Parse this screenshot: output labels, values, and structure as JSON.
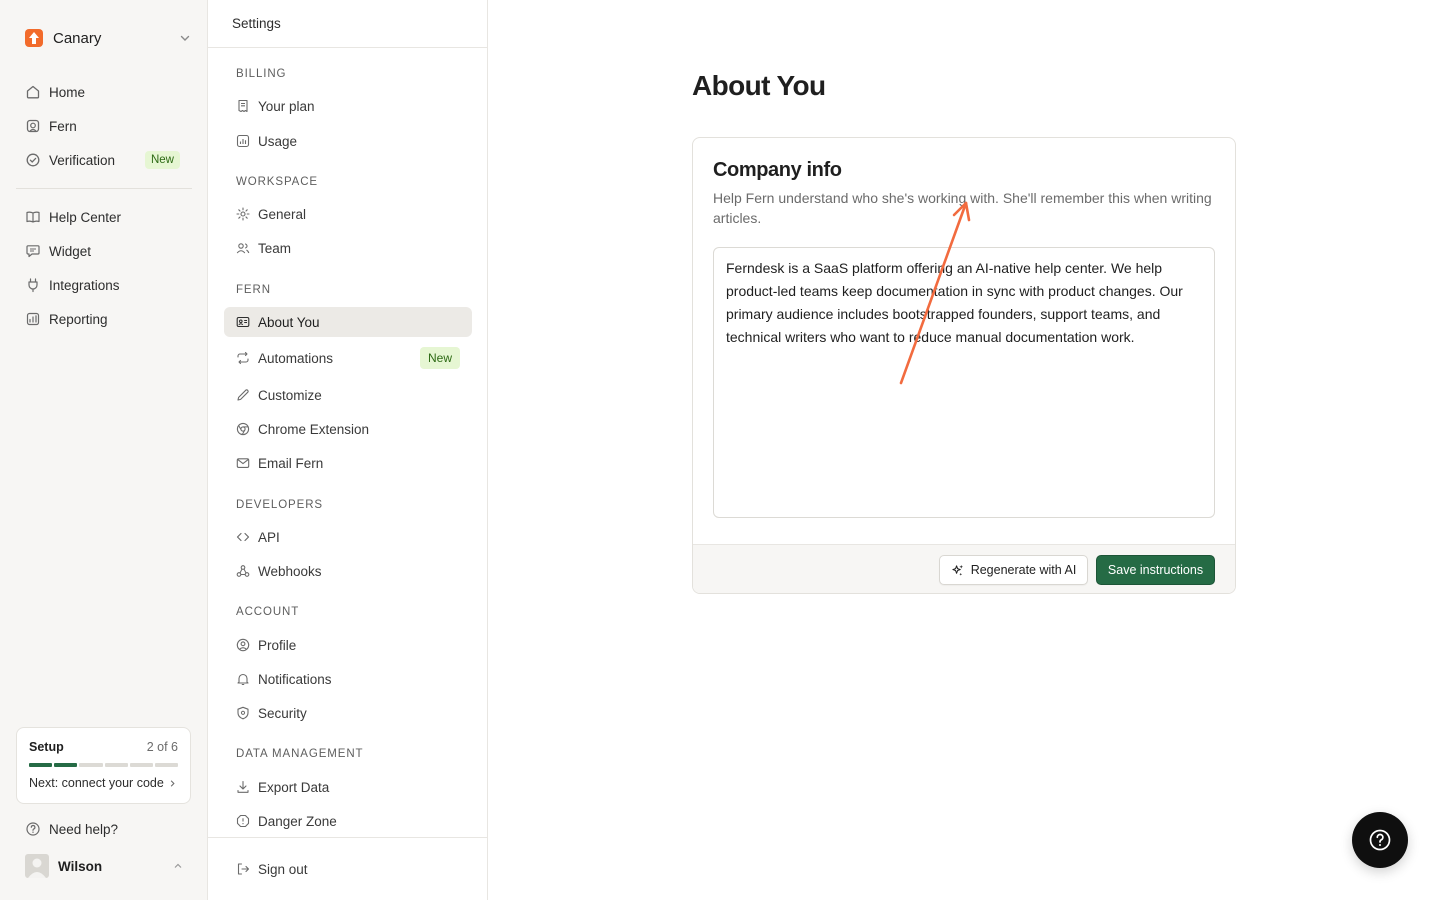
{
  "workspace": {
    "name": "Canary",
    "logo_color": "#f26b2b"
  },
  "app_nav": {
    "primary": [
      {
        "label": "Home",
        "icon": "home-icon"
      },
      {
        "label": "Fern",
        "icon": "fern-icon"
      },
      {
        "label": "Verification",
        "icon": "check-circle-icon",
        "badge": "New"
      }
    ],
    "secondary": [
      {
        "label": "Help Center",
        "icon": "book-icon"
      },
      {
        "label": "Widget",
        "icon": "chat-icon"
      },
      {
        "label": "Integrations",
        "icon": "plug-icon"
      },
      {
        "label": "Reporting",
        "icon": "chart-icon"
      }
    ]
  },
  "setup": {
    "title": "Setup",
    "count": "2 of 6",
    "completed": 2,
    "total": 6,
    "next": "Next: connect your code"
  },
  "help_link": "Need help?",
  "user": {
    "name": "Wilson"
  },
  "settings": {
    "header": "Settings",
    "sections": {
      "billing": "BILLING",
      "workspace": "WORKSPACE",
      "fern": "FERN",
      "developers": "DEVELOPERS",
      "account": "ACCOUNT",
      "data": "DATA MANAGEMENT"
    },
    "items": {
      "your_plan": "Your plan",
      "usage": "Usage",
      "general": "General",
      "team": "Team",
      "about_you": "About You",
      "automations": "Automations",
      "automations_badge": "New",
      "customize": "Customize",
      "chrome_extension": "Chrome Extension",
      "email_fern": "Email Fern",
      "api": "API",
      "webhooks": "Webhooks",
      "profile": "Profile",
      "notifications": "Notifications",
      "security": "Security",
      "export_data": "Export Data",
      "danger_zone": "Danger Zone",
      "sign_out": "Sign out"
    },
    "active": "About You"
  },
  "main": {
    "title": "About You",
    "card": {
      "title": "Company info",
      "description": "Help Fern understand who she's working with. She'll remember this when writing articles.",
      "textarea_value": "Ferndesk is a SaaS platform offering an AI-native help center. We help product-led teams keep documentation in sync with product changes. Our primary audience includes bootstrapped founders, support teams, and technical writers who want to reduce manual documentation work.",
      "regenerate_label": "Regenerate with AI",
      "save_label": "Save instructions"
    }
  },
  "colors": {
    "accent_green": "#256b45",
    "badge_bg": "#e6f6d3",
    "annotation_arrow": "#f26b3f"
  }
}
